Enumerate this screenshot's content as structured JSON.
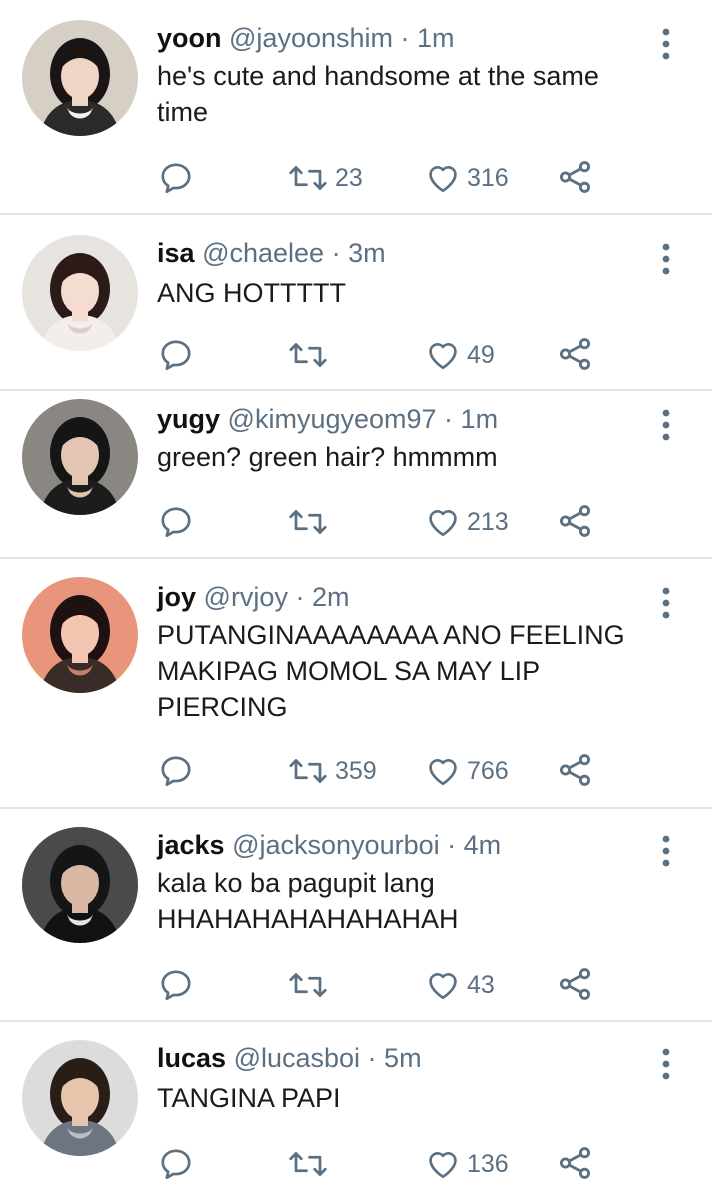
{
  "tweets": [
    {
      "name": "yoon",
      "handle": "@jayoonshim",
      "sep": " · ",
      "time": "1m",
      "text": "he's cute and handsome at the same time",
      "retweets": "23",
      "likes": "316",
      "avatar": {
        "bg": "#d6cfc6",
        "skin": "#efd5c6",
        "hair": "#1a1414",
        "shirt": "#2a2a2a",
        "shirt_accent": "#f2f2f2"
      }
    },
    {
      "name": "isa",
      "handle": "@chaelee",
      "sep": " · ",
      "time": "3m",
      "text": "ANG HOTTTTT",
      "retweets": "",
      "likes": "49",
      "avatar": {
        "bg": "#e7e3de",
        "skin": "#f4dcd0",
        "hair": "#2b1a17",
        "shirt": "#f4eeea",
        "shirt_accent": "#d9cfca"
      }
    },
    {
      "name": "yugy",
      "handle": "@kimyugyeom97",
      "sep": " · ",
      "time": "1m",
      "text": "green? green hair? hmmmm",
      "retweets": "",
      "likes": "213",
      "avatar": {
        "bg": "#8a8782",
        "skin": "#e3c6b2",
        "hair": "#151515",
        "shirt": "#1c1c1c",
        "shirt_accent": "#d9c9a4"
      }
    },
    {
      "name": "joy",
      "handle": "@rvjoy",
      "sep": " · ",
      "time": "2m",
      "text": "PUTANGINAAAAAAAA ANO FEELING MAKIPAG MOMOL SA MAY LIP PIERCING",
      "retweets": "359",
      "likes": "766",
      "avatar": {
        "bg": "#e8957b",
        "skin": "#f2c6b1",
        "hair": "#1d1211",
        "shirt": "#3a2a28",
        "shirt_accent": "#c77f6b"
      }
    },
    {
      "name": "jacks",
      "handle": "@jacksonyourboi",
      "sep": " · ",
      "time": "4m",
      "text": "kala ko ba pagupit lang HHAHAHAHAHAHAHAH",
      "retweets": "",
      "likes": "43",
      "avatar": {
        "bg": "#4a4a4a",
        "skin": "#d9b8a3",
        "hair": "#151515",
        "shirt": "#121212",
        "shirt_accent": "#e6e6e6"
      }
    },
    {
      "name": "lucas",
      "handle": "@lucasboi",
      "sep": " · ",
      "time": "5m",
      "text": "TANGINA PAPI",
      "retweets": "",
      "likes": "136",
      "avatar": {
        "bg": "#dcdcdc",
        "skin": "#e6c5ad",
        "hair": "#2a1d18",
        "shirt": "#6d7680",
        "shirt_accent": "#b9c0c6"
      }
    }
  ],
  "colors": {
    "icon": "#5b7083",
    "divider": "#e3e6e8",
    "text": "#1b1b1b",
    "meta": "#5b7083"
  },
  "icons": {
    "reply": "reply-icon",
    "retweet": "retweet-icon",
    "like": "heart-icon",
    "share": "share-icon",
    "menu": "more-vertical-icon"
  }
}
